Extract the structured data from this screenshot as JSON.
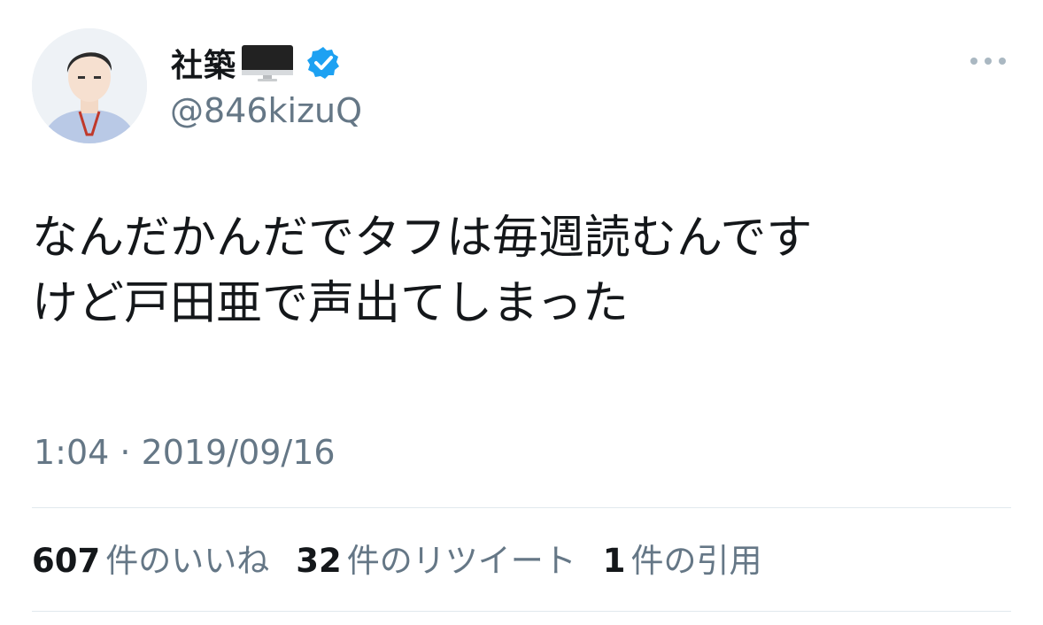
{
  "user": {
    "display_name": "社築",
    "name_emoji_icon": "desktop-computer-icon",
    "verified_icon": "verified-badge-icon",
    "handle": "@846kizuQ"
  },
  "tweet": {
    "text_lines": [
      "なんだかんだでタフは毎週読むんです",
      "けど戸田亜で声出てしまった"
    ],
    "timestamp": "1:04 · 2019/09/16"
  },
  "stats": [
    {
      "count": "607",
      "label": "件のいいね"
    },
    {
      "count": "32",
      "label": "件のリツイート"
    },
    {
      "count": "1",
      "label": "件の引用"
    }
  ],
  "colors": {
    "text_primary": "#14171a",
    "text_secondary": "#657786",
    "verified_blue": "#1da1f2",
    "divider": "#e1e8ed"
  }
}
